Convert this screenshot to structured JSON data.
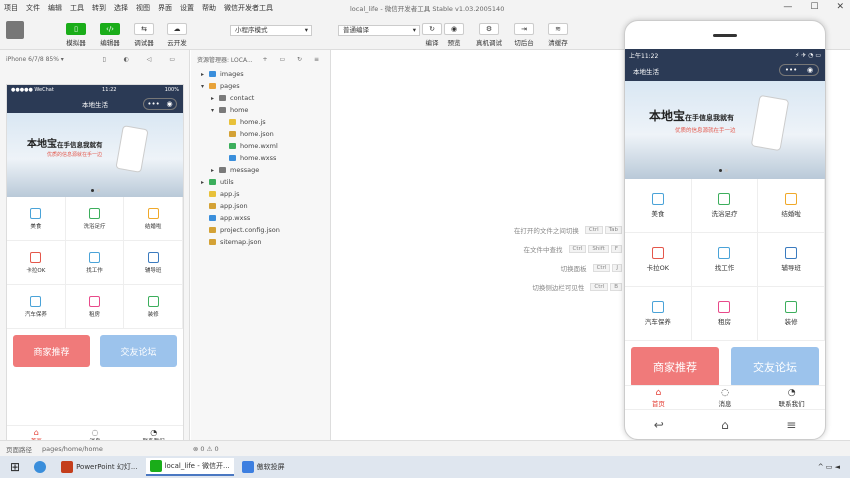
{
  "menu": [
    "项目",
    "文件",
    "编辑",
    "工具",
    "转到",
    "选择",
    "视图",
    "界面",
    "设置",
    "帮助",
    "微信开发者工具"
  ],
  "window_title": "local_life - 微信开发者工具 Stable v1.03.2005140",
  "window_controls": [
    "—",
    "☐",
    "✕"
  ],
  "toolbar": {
    "left": [
      {
        "label": "模拟器",
        "icon": "phone-icon"
      },
      {
        "label": "编辑器",
        "icon": "code-icon"
      },
      {
        "label": "调试器",
        "icon": "debug-icon"
      },
      {
        "label": "云开发",
        "icon": "cloud-icon"
      }
    ],
    "mode_select": "小程序模式",
    "compile_select": "普通编译",
    "right": [
      {
        "label": "编译",
        "icon": "refresh-icon"
      },
      {
        "label": "预览",
        "icon": "eye-icon"
      },
      {
        "label": "真机调试",
        "icon": "gear-icon"
      },
      {
        "label": "切后台",
        "icon": "switch-icon"
      },
      {
        "label": "清缓存",
        "icon": "layers-icon"
      }
    ]
  },
  "simulator": {
    "device": "iPhone 6/7/8 85% ▾",
    "status_carrier": "●●●●● WeChat",
    "status_time": "11:22",
    "status_battery": "100%",
    "nav_title": "本地生活"
  },
  "banner": {
    "title_big": "本地宝",
    "title_small": "在手信息我就有",
    "subtitle": "优质的信息源就在手一边"
  },
  "grid_items": [
    {
      "label": "美食",
      "color": "#4aa3d8"
    },
    {
      "label": "洗浴足疗",
      "color": "#3cae5c"
    },
    {
      "label": "结婚啦",
      "color": "#f0a92a"
    },
    {
      "label": "卡拉OK",
      "color": "#e4574b"
    },
    {
      "label": "找工作",
      "color": "#4aa3d8"
    },
    {
      "label": "辅导班",
      "color": "#3b7bbf"
    },
    {
      "label": "汽车保养",
      "color": "#4aa3d8"
    },
    {
      "label": "租房",
      "color": "#e84a8a"
    },
    {
      "label": "装修",
      "color": "#3cae5c"
    }
  ],
  "promo": [
    {
      "label": "商家推荐",
      "color": "#f07a7a"
    },
    {
      "label": "交友论坛",
      "color": "#9cc3ec"
    }
  ],
  "tabs": [
    {
      "label": "首页",
      "active": true
    },
    {
      "label": "消息",
      "active": false
    },
    {
      "label": "联系我们",
      "active": false
    }
  ],
  "explorer": {
    "header": "资源管理器: LOCA...",
    "tree": [
      {
        "label": "images",
        "depth": 0,
        "type": "folder-blue",
        "arrow": "▸"
      },
      {
        "label": "pages",
        "depth": 0,
        "type": "folder-orange",
        "arrow": "▾"
      },
      {
        "label": "contact",
        "depth": 1,
        "type": "folder",
        "arrow": "▸"
      },
      {
        "label": "home",
        "depth": 1,
        "type": "folder",
        "arrow": "▾"
      },
      {
        "label": "home.js",
        "depth": 2,
        "type": "js"
      },
      {
        "label": "home.json",
        "depth": 2,
        "type": "json"
      },
      {
        "label": "home.wxml",
        "depth": 2,
        "type": "wxml"
      },
      {
        "label": "home.wxss",
        "depth": 2,
        "type": "wxss"
      },
      {
        "label": "message",
        "depth": 1,
        "type": "folder",
        "arrow": "▸"
      },
      {
        "label": "utils",
        "depth": 0,
        "type": "folder-green",
        "arrow": "▸"
      },
      {
        "label": "app.js",
        "depth": 0,
        "type": "js"
      },
      {
        "label": "app.json",
        "depth": 0,
        "type": "json"
      },
      {
        "label": "app.wxss",
        "depth": 0,
        "type": "wxss"
      },
      {
        "label": "project.config.json",
        "depth": 0,
        "type": "json"
      },
      {
        "label": "sitemap.json",
        "depth": 0,
        "type": "json"
      }
    ]
  },
  "shortcuts": [
    {
      "label": "在打开的文件之间切换",
      "keys": [
        "Ctrl",
        "Tab"
      ]
    },
    {
      "label": "在文件中查找",
      "keys": [
        "Ctrl",
        "Shift",
        "F"
      ]
    },
    {
      "label": "切换面板",
      "keys": [
        "Ctrl",
        "J"
      ]
    },
    {
      "label": "切换侧边栏可见性",
      "keys": [
        "Ctrl",
        "B"
      ]
    }
  ],
  "big_phone": {
    "status_time": "上午11:22",
    "status_icons": "⚡ ✈ ◔ ▭",
    "nav_title": "本地生活",
    "nav_menu": "•••"
  },
  "status_bar": {
    "path_label": "页面路径",
    "path": "pages/home/home",
    "errors": "⊗ 0 ⚠ 0"
  },
  "taskbar": [
    {
      "label": "",
      "color": "#1f1f1f"
    },
    {
      "label": "",
      "color": "#3a8edb"
    },
    {
      "label": "PowerPoint 幻灯...",
      "color": "#c43e1c"
    },
    {
      "label": "local_life - 微信开...",
      "color": "#1aad19"
    },
    {
      "label": "傲软投屏",
      "color": "#3d7fe0"
    }
  ]
}
